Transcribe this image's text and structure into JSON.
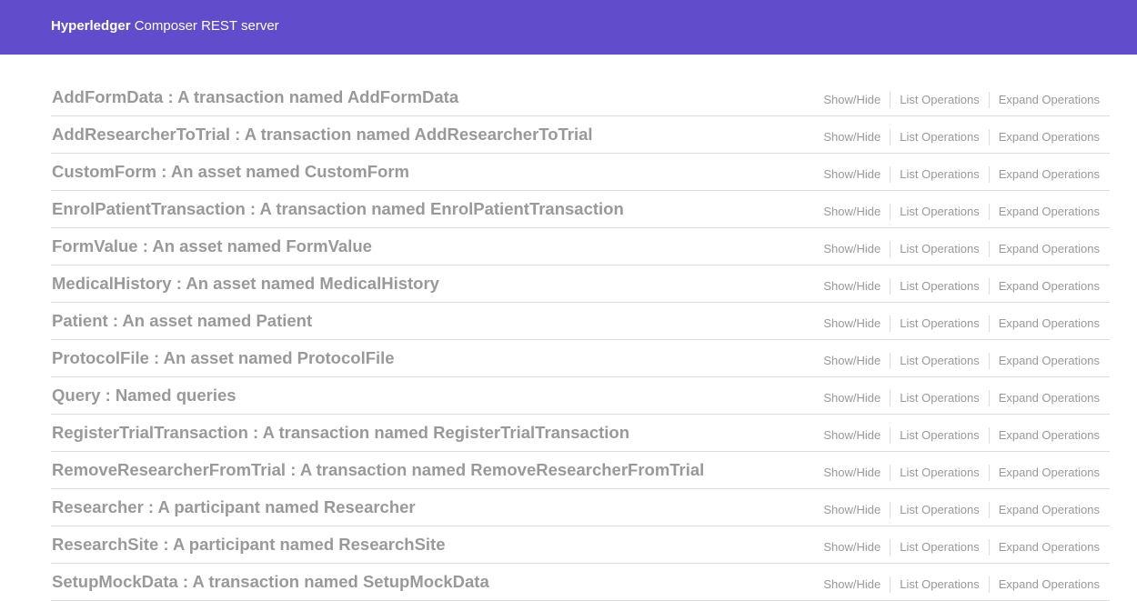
{
  "header": {
    "brand_strong": "Hyperledger",
    "brand_rest": " Composer REST server",
    "background": "#614dcb"
  },
  "operations": {
    "show_hide": "Show/Hide",
    "list": "List Operations",
    "expand": "Expand Operations"
  },
  "resources": [
    {
      "title": "AddFormData : A transaction named AddFormData"
    },
    {
      "title": "AddResearcherToTrial : A transaction named AddResearcherToTrial"
    },
    {
      "title": "CustomForm : An asset named CustomForm"
    },
    {
      "title": "EnrolPatientTransaction : A transaction named EnrolPatientTransaction"
    },
    {
      "title": "FormValue : An asset named FormValue"
    },
    {
      "title": "MedicalHistory : An asset named MedicalHistory"
    },
    {
      "title": "Patient : An asset named Patient"
    },
    {
      "title": "ProtocolFile : An asset named ProtocolFile"
    },
    {
      "title": "Query : Named queries"
    },
    {
      "title": "RegisterTrialTransaction : A transaction named RegisterTrialTransaction"
    },
    {
      "title": "RemoveResearcherFromTrial : A transaction named RemoveResearcherFromTrial"
    },
    {
      "title": "Researcher : A participant named Researcher"
    },
    {
      "title": "ResearchSite : A participant named ResearchSite"
    },
    {
      "title": "SetupMockData : A transaction named SetupMockData"
    }
  ]
}
